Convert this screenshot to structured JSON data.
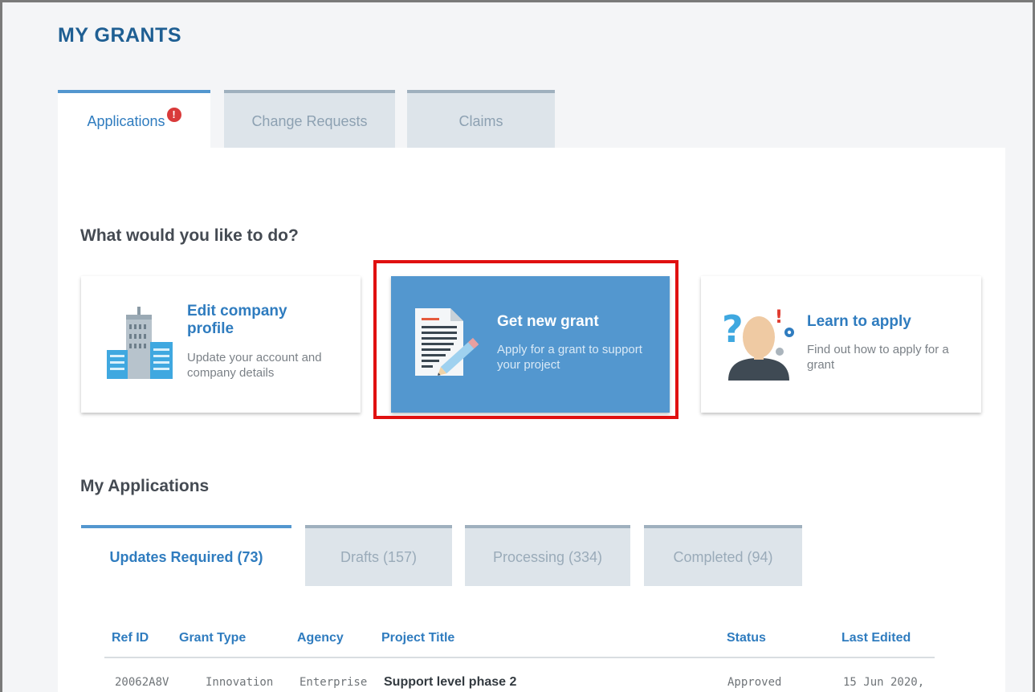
{
  "page": {
    "title": "MY GRANTS"
  },
  "main_tabs": [
    {
      "label": "Applications",
      "badge": "!",
      "active": true
    },
    {
      "label": "Change Requests",
      "active": false
    },
    {
      "label": "Claims",
      "active": false
    }
  ],
  "actions": {
    "heading": "What would you like to do?",
    "cards": [
      {
        "title": "Edit company profile",
        "description": "Update your account and company details",
        "icon": "building-icon"
      },
      {
        "title": "Get new grant",
        "description": "Apply for a grant to support your project",
        "icon": "document-pencil-icon",
        "highlighted": true
      },
      {
        "title": "Learn to apply",
        "description": "Find out how to apply for a grant",
        "icon": "person-question-icon"
      }
    ]
  },
  "applications": {
    "heading": "My Applications",
    "tabs": [
      {
        "label": "Updates Required (73)",
        "active": true
      },
      {
        "label": "Drafts (157)",
        "active": false
      },
      {
        "label": "Processing (334)",
        "active": false
      },
      {
        "label": "Completed (94)",
        "active": false
      }
    ],
    "columns": [
      "Ref ID",
      "Grant Type",
      "Agency",
      "Project Title",
      "Status",
      "Last Edited"
    ],
    "rows": [
      [
        "20062A8V",
        "Innovation",
        "Enterprise",
        "Support level phase 2",
        "Approved",
        "15 Jun 2020,"
      ]
    ]
  },
  "colors": {
    "brand": "#1f5f93",
    "accent": "#5397cf",
    "highlight": "#e01010",
    "badge": "#d93a3a"
  }
}
